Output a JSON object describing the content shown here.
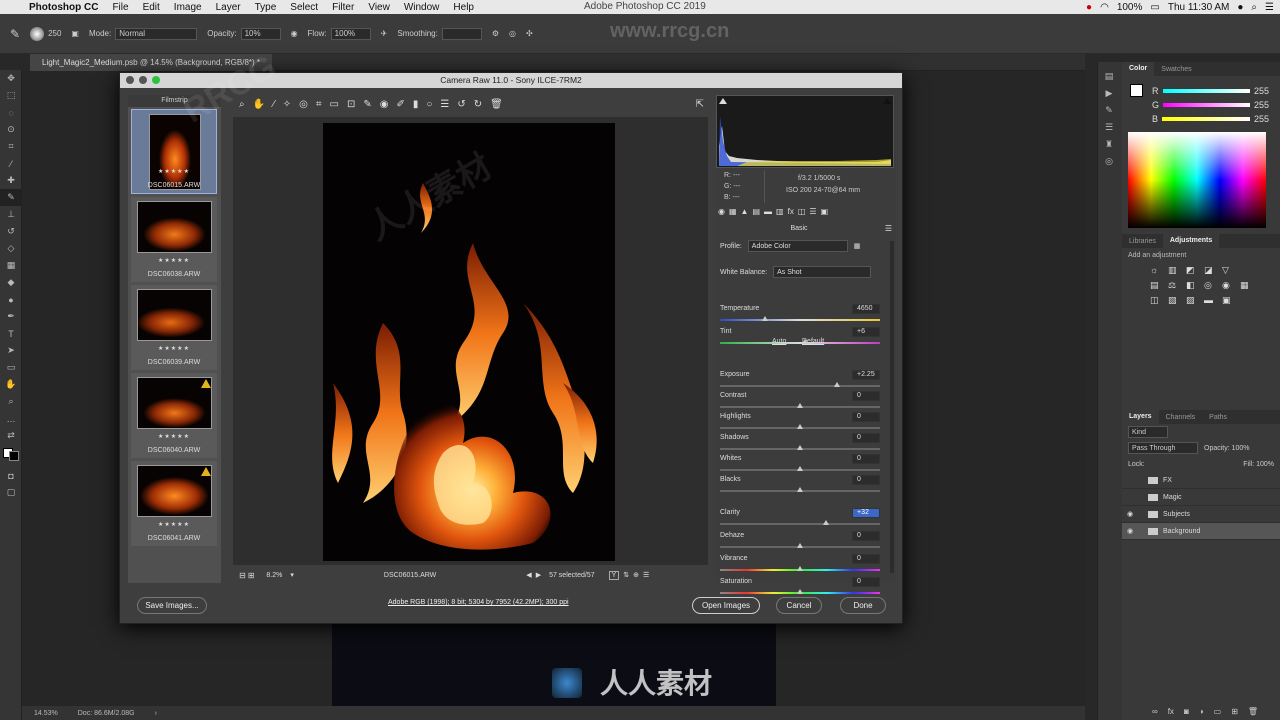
{
  "menubar": {
    "apple": "",
    "app": "Photoshop CC",
    "items": [
      "File",
      "Edit",
      "Image",
      "Layer",
      "Type",
      "Select",
      "Filter",
      "View",
      "Window",
      "Help"
    ],
    "center_title": "Adobe Photoshop CC 2019",
    "battery": "100%",
    "clock": "Thu 11:30 AM"
  },
  "optionsbar": {
    "brush_size": "250",
    "mode_label": "Mode:",
    "mode_value": "Normal",
    "opacity_label": "Opacity:",
    "opacity_value": "10%",
    "flow_label": "Flow:",
    "flow_value": "100%",
    "smoothing_label": "Smoothing:"
  },
  "document": {
    "tab": "Light_Magic2_Medium.psb @ 14.5% (Background, RGB/8*) *",
    "zoom": "14.53%",
    "doc_size": "Doc: 86.6M/2.08G"
  },
  "dialog": {
    "title": "Camera Raw 11.0  -  Sony ILCE-7RM2",
    "filmstrip_title": "Filmstrip",
    "thumbs": [
      {
        "name": "DSC06015.ARW",
        "stars": "★★★★★",
        "warn": false
      },
      {
        "name": "DSC06038.ARW",
        "stars": "★★★★★",
        "warn": false
      },
      {
        "name": "DSC06039.ARW",
        "stars": "★★★★★",
        "warn": false
      },
      {
        "name": "DSC06040.ARW",
        "stars": "★★★★★",
        "warn": true
      },
      {
        "name": "DSC06041.ARW",
        "stars": "★★★★★",
        "warn": true
      }
    ],
    "zoom": "8.2%",
    "filename": "DSC06015.ARW",
    "selected": "57 selected/57",
    "rgb": {
      "r": "R:  ---",
      "g": "G:  ---",
      "b": "B:  ---"
    },
    "exif": {
      "line1": "f/3.2   1/5000 s",
      "line2": "ISO 200   24-70@64 mm"
    },
    "panel_title": "Basic",
    "profile_label": "Profile:",
    "profile_value": "Adobe Color",
    "wb_label": "White Balance:",
    "wb_value": "As Shot",
    "auto": "Auto",
    "default": "Default",
    "sliders": [
      {
        "label": "Temperature",
        "value": "4650",
        "pos": 0.28,
        "highlight": false
      },
      {
        "label": "Tint",
        "value": "+6",
        "pos": 0.53,
        "highlight": false
      },
      {
        "label": "Exposure",
        "value": "+2.25",
        "pos": 0.73,
        "highlight": false
      },
      {
        "label": "Contrast",
        "value": "0",
        "pos": 0.5,
        "highlight": false
      },
      {
        "label": "Highlights",
        "value": "0",
        "pos": 0.5,
        "highlight": false
      },
      {
        "label": "Shadows",
        "value": "0",
        "pos": 0.5,
        "highlight": false
      },
      {
        "label": "Whites",
        "value": "0",
        "pos": 0.5,
        "highlight": false
      },
      {
        "label": "Blacks",
        "value": "0",
        "pos": 0.5,
        "highlight": false
      },
      {
        "label": "Clarity",
        "value": "+32",
        "pos": 0.66,
        "highlight": true
      },
      {
        "label": "Dehaze",
        "value": "0",
        "pos": 0.5,
        "highlight": false
      },
      {
        "label": "Vibrance",
        "value": "0",
        "pos": 0.5,
        "highlight": false
      },
      {
        "label": "Saturation",
        "value": "0",
        "pos": 0.5,
        "highlight": false
      }
    ],
    "save_button": "Save Images...",
    "workflow_info": "Adobe RGB (1998); 8 bit; 5304 by 7952 (42.2MP); 300 ppi",
    "open_button": "Open Images",
    "cancel_button": "Cancel",
    "done_button": "Done"
  },
  "panels": {
    "color_tabs": [
      "Color",
      "Swatches"
    ],
    "rgb_values": [
      "255",
      "255",
      "255"
    ],
    "rgb_labels": [
      "R",
      "G",
      "B"
    ],
    "adj_tabs": [
      "Libraries",
      "Adjustments"
    ],
    "adj_hint": "Add an adjustment",
    "layer_tabs": [
      "Layers",
      "Channels",
      "Paths"
    ],
    "kind": "Kind",
    "blend": "Pass Through",
    "opacity": "Opacity: 100%",
    "lock": "Lock:",
    "fill": "Fill: 100%",
    "layers": [
      {
        "name": "FX",
        "visible": false
      },
      {
        "name": "Magic",
        "visible": false
      },
      {
        "name": "Subjects",
        "visible": true
      },
      {
        "name": "Background",
        "visible": true
      }
    ]
  },
  "watermarks": [
    "RRCG",
    "人人素材",
    "www.rrcg.cn",
    "人人素材"
  ]
}
